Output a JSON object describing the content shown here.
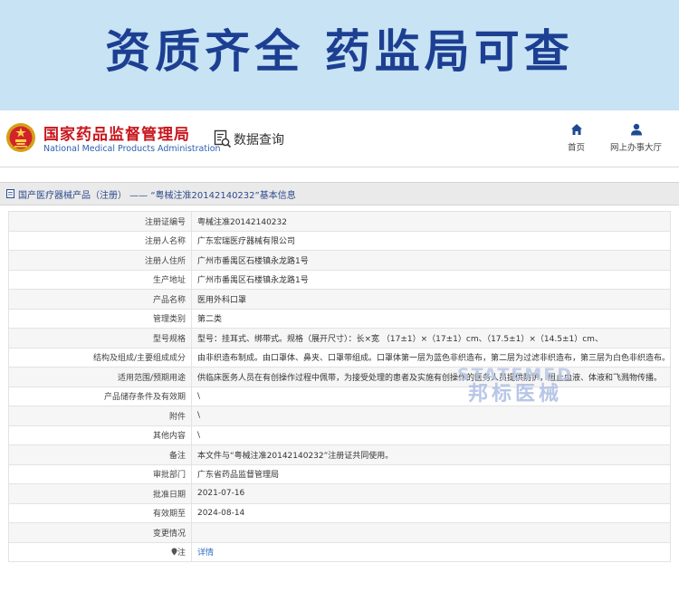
{
  "banner": {
    "title": "资质齐全 药监局可查"
  },
  "header": {
    "org_name_cn": "国家药品监督管理局",
    "org_name_en": "National Medical Products Administration",
    "data_query": "数据查询",
    "nav": [
      {
        "label": "首页",
        "icon": "home-icon"
      },
      {
        "label": "网上办事大厅",
        "icon": "user-icon"
      }
    ]
  },
  "breadcrumb": {
    "text": "国产医疗器械产品（注册） —— “粤械注准20142140232”基本信息"
  },
  "rows": [
    {
      "label": "注册证编号",
      "value": "粤械注准20142140232"
    },
    {
      "label": "注册人名称",
      "value": "广东宏瑞医疗器械有限公司"
    },
    {
      "label": "注册人住所",
      "value": "广州市番禺区石楼镇永龙路1号"
    },
    {
      "label": "生产地址",
      "value": "广州市番禺区石楼镇永龙路1号"
    },
    {
      "label": "产品名称",
      "value": "医用外科口罩"
    },
    {
      "label": "管理类别",
      "value": "第二类"
    },
    {
      "label": "型号规格",
      "value": "型号：挂耳式、绑带式。规格（展开尺寸）：长×宽 （17±1）×（17±1）cm、（17.5±1）×（14.5±1）cm、"
    },
    {
      "label": "结构及组成/主要组成成分",
      "value": "由非织造布制成。由口罩体、鼻夹、口罩带组成。口罩体第一层为蓝色非织造布，第二层为过滤非织造布，第三层为白色非织造布。"
    },
    {
      "label": "适用范围/预期用途",
      "value": "供临床医务人员在有创操作过程中佩带，为接受处理的患者及实施有创操作的医务人员提供防护，阻止血液、体液和飞溅物传播。"
    },
    {
      "label": "产品储存条件及有效期",
      "value": "\\"
    },
    {
      "label": "附件",
      "value": "\\"
    },
    {
      "label": "其他内容",
      "value": "\\"
    },
    {
      "label": "备注",
      "value": "本文件与“粤械注准20142140232”注册证共同使用。"
    },
    {
      "label": "审批部门",
      "value": "广东省药品监督管理局"
    },
    {
      "label": "批准日期",
      "value": "2021-07-16"
    },
    {
      "label": "有效期至",
      "value": "2024-08-14"
    },
    {
      "label": "变更情况",
      "value": ""
    },
    {
      "label": "注",
      "value": "详情"
    }
  ],
  "watermark": {
    "en": "STATEMED",
    "cn": "邦标医械"
  },
  "colors": {
    "banner_bg": "#c7e3f4",
    "banner_text": "#1d3f92",
    "org_red": "#c8161d",
    "link_blue": "#2a6fc1",
    "crumb_bg": "#eaeaea"
  }
}
